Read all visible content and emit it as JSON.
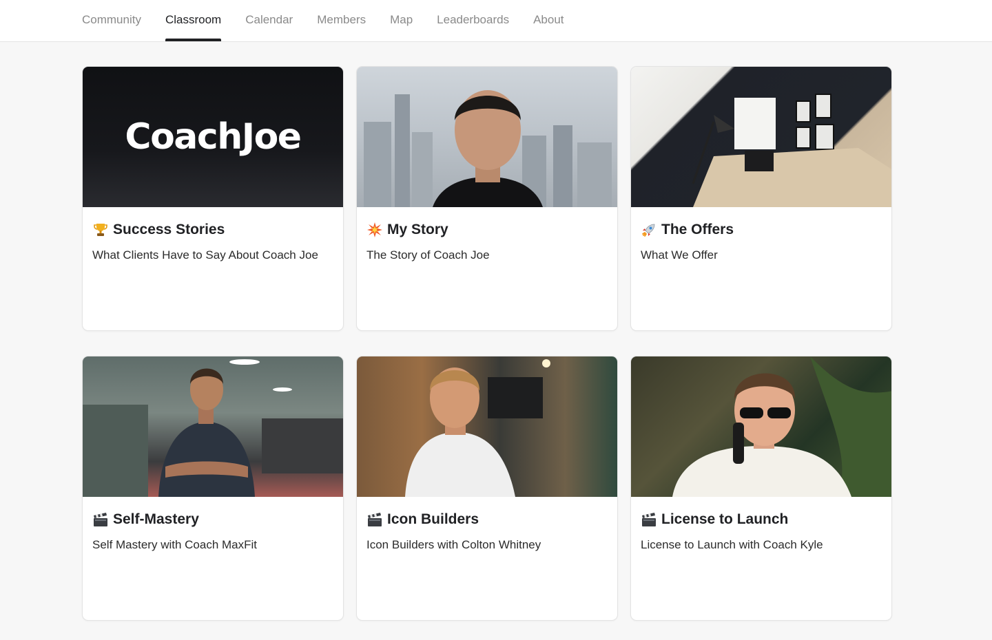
{
  "nav": {
    "tabs": [
      {
        "label": "Community",
        "active": false
      },
      {
        "label": "Classroom",
        "active": true
      },
      {
        "label": "Calendar",
        "active": false
      },
      {
        "label": "Members",
        "active": false
      },
      {
        "label": "Map",
        "active": false
      },
      {
        "label": "Leaderboards",
        "active": false
      },
      {
        "label": "About",
        "active": false
      }
    ]
  },
  "courses": [
    {
      "icon": "trophy-icon",
      "title": "Success Stories",
      "subtitle": "What Clients Have to Say About Coach Joe",
      "thumbnail_text": "CoachJoe"
    },
    {
      "icon": "collision-icon",
      "title": "My Story",
      "subtitle": "The Story of Coach Joe"
    },
    {
      "icon": "rocket-icon",
      "title": "The Offers",
      "subtitle": "What We Offer"
    },
    {
      "icon": "clapper-board-icon",
      "title": "Self-Mastery",
      "subtitle": "Self Mastery with Coach MaxFit"
    },
    {
      "icon": "clapper-board-icon",
      "title": "Icon Builders",
      "subtitle": "Icon Builders with Colton Whitney"
    },
    {
      "icon": "clapper-board-icon",
      "title": "License to Launch",
      "subtitle": "License to Launch with Coach Kyle"
    }
  ],
  "colors": {
    "page_bg": "#f7f7f7",
    "active_tab": "#202124",
    "inactive_tab": "#8a8a8a"
  }
}
